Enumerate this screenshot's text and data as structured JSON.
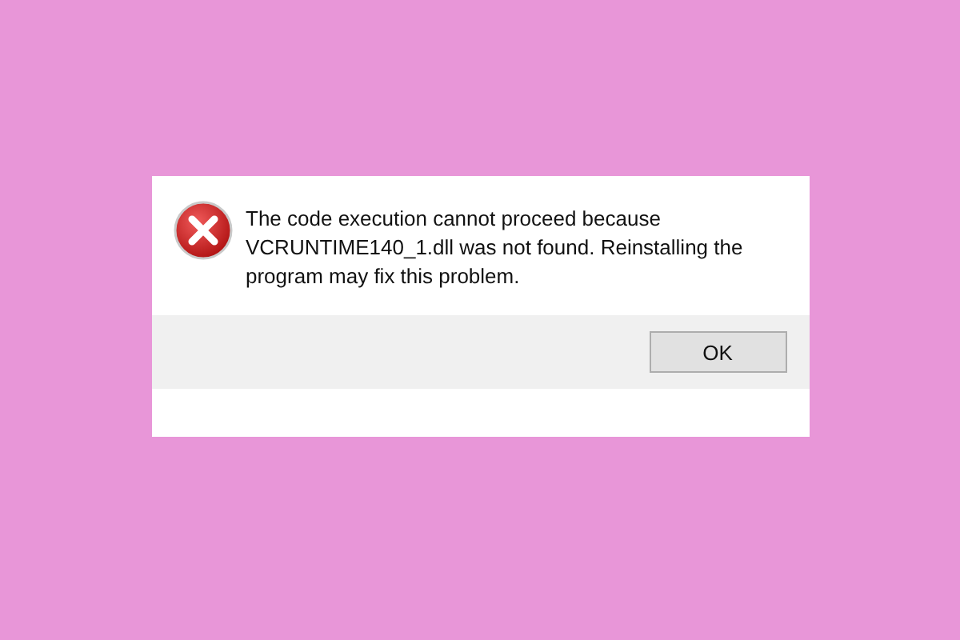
{
  "dialog": {
    "kind": "error",
    "message": "The code execution cannot proceed because VCRUNTIME140_1.dll was not found. Reinstalling the program may fix this problem.",
    "buttons": [
      "OK"
    ]
  }
}
